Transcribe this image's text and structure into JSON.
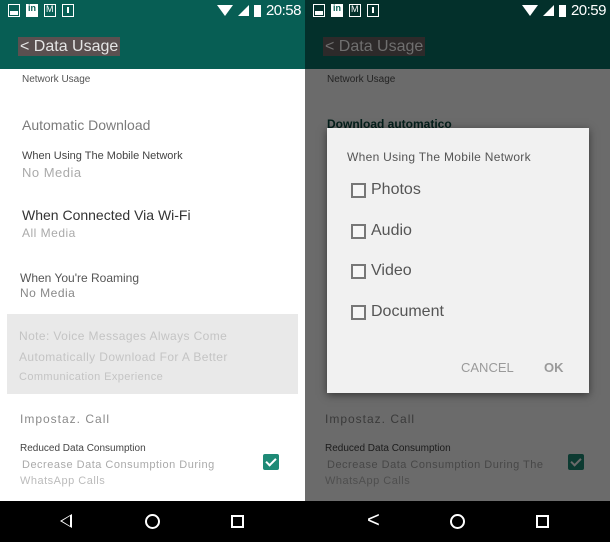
{
  "screens": [
    {
      "status": {
        "time": "20:58"
      },
      "appbar": {
        "title": "< Data Usage"
      },
      "content": {
        "network_usage": "Network Usage",
        "automatic_download_header": "Automatic Download",
        "mobile_network": {
          "label": "When Using The Mobile Network",
          "value": "No Media"
        },
        "wifi": {
          "label": "When Connected Via Wi-Fi",
          "value": "All Media"
        },
        "roaming": {
          "label": "When You're Roaming",
          "value": "No Media"
        },
        "note": {
          "line1": "Note: Voice Messages Always Come",
          "line2": "Automatically Download For A Better",
          "line3": "Communication Experience"
        },
        "calls_header": "Impostaz. Call",
        "reduced_data": {
          "label": "Reduced Data Consumption",
          "desc_line1": "Decrease Data Consumption During",
          "desc_line2": "WhatsApp Calls",
          "checked": true
        }
      }
    },
    {
      "status": {
        "time": "20:59"
      },
      "appbar": {
        "title": "< Data Usage"
      },
      "content": {
        "network_usage": "Network Usage",
        "automatic_download_header": "Download automatico",
        "calls_header": "Impostaz. Call",
        "reduced_data": {
          "label": "Reduced Data Consumption",
          "desc_line1": "Decrease Data Consumption During The",
          "desc_line2": "WhatsApp Calls",
          "checked": true
        }
      },
      "dialog": {
        "title": "When Using The Mobile Network",
        "options": [
          {
            "label": "Photos",
            "checked": false
          },
          {
            "label": "Audio",
            "checked": false
          },
          {
            "label": "Video",
            "checked": false
          },
          {
            "label": "Document",
            "checked": false
          }
        ],
        "cancel_label": "CANCEL",
        "ok_label": "OK"
      }
    }
  ],
  "colors": {
    "primary": "#075e54",
    "primary_dark_dimmed": "#03302b",
    "accent": "#1e8a76"
  }
}
